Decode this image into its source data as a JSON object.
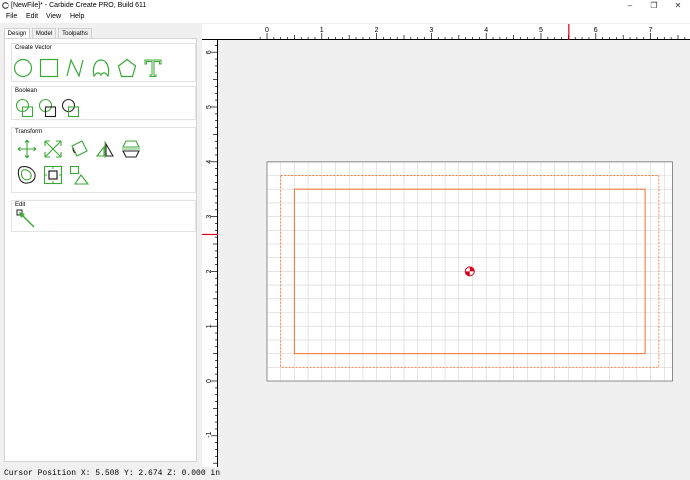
{
  "window": {
    "title": "[NewFile]* - Carbide Create PRO, Build 611",
    "minimize_icon": "minimize-icon",
    "restore_icon": "restore-icon",
    "close_icon": "close-icon"
  },
  "menu": {
    "items": [
      "File",
      "Edit",
      "View",
      "Help"
    ]
  },
  "tabs": {
    "items": [
      "Design",
      "Model",
      "Toolpaths"
    ],
    "active": "Design"
  },
  "groups": {
    "create_vector": {
      "title": "Create Vector",
      "tools": [
        "circle-icon",
        "rectangle-icon",
        "polyline-icon",
        "curve-icon",
        "polygon-icon",
        "text-icon"
      ]
    },
    "boolean": {
      "title": "Boolean",
      "tools": [
        "union-icon",
        "subtract-icon",
        "intersect-icon"
      ]
    },
    "transform": {
      "title": "Transform",
      "tools": [
        "move-icon",
        "scale-icon",
        "rotate-icon",
        "mirror-icon",
        "align-icon",
        "offset-icon",
        "center-icon",
        "array-icon"
      ]
    },
    "edit": {
      "title": "Edit",
      "tools": [
        "node-edit-icon"
      ]
    }
  },
  "ruler": {
    "x_labels": [
      "0",
      "1",
      "2",
      "3",
      "4",
      "5",
      "6",
      "7"
    ],
    "y_labels": [
      "6",
      "5",
      "4",
      "3",
      "2",
      "1",
      "0",
      "-1"
    ],
    "cursor_marker_color": "#d9001b"
  },
  "canvas": {
    "stock_color": "#f47c3c",
    "origin_marker": "origin-icon"
  },
  "status": {
    "cursor_position": "Cursor Position X: 5.508 Y: 2.674 Z: 0.000 in"
  },
  "colors": {
    "tool_icon": "#3aa835",
    "tool_icon_dark": "#222222"
  }
}
